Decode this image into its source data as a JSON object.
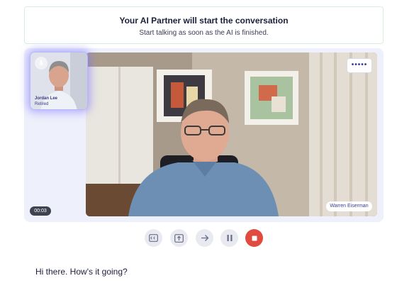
{
  "banner": {
    "title": "Your AI Partner will start the conversation",
    "subtitle": "Start talking as soon as the AI is finished."
  },
  "partner": {
    "name": "Jordan Lee",
    "role": "Retired",
    "mic_icon": "mic-icon"
  },
  "user": {
    "name": "Warren Eiserman"
  },
  "call": {
    "timer": "00:03",
    "more_label": "•••••"
  },
  "controls": [
    {
      "name": "captions-icon"
    },
    {
      "name": "share-screen-icon"
    },
    {
      "name": "next-arrow-icon"
    },
    {
      "name": "pause-icon"
    },
    {
      "name": "stop-icon"
    }
  ],
  "transcript": {
    "text": "Hi there. How's it going?"
  },
  "colors": {
    "accent": "#6b63ff",
    "stop": "#e14a3e",
    "banner_border": "#d7efdc",
    "stage_bg": "#eef0fb"
  }
}
